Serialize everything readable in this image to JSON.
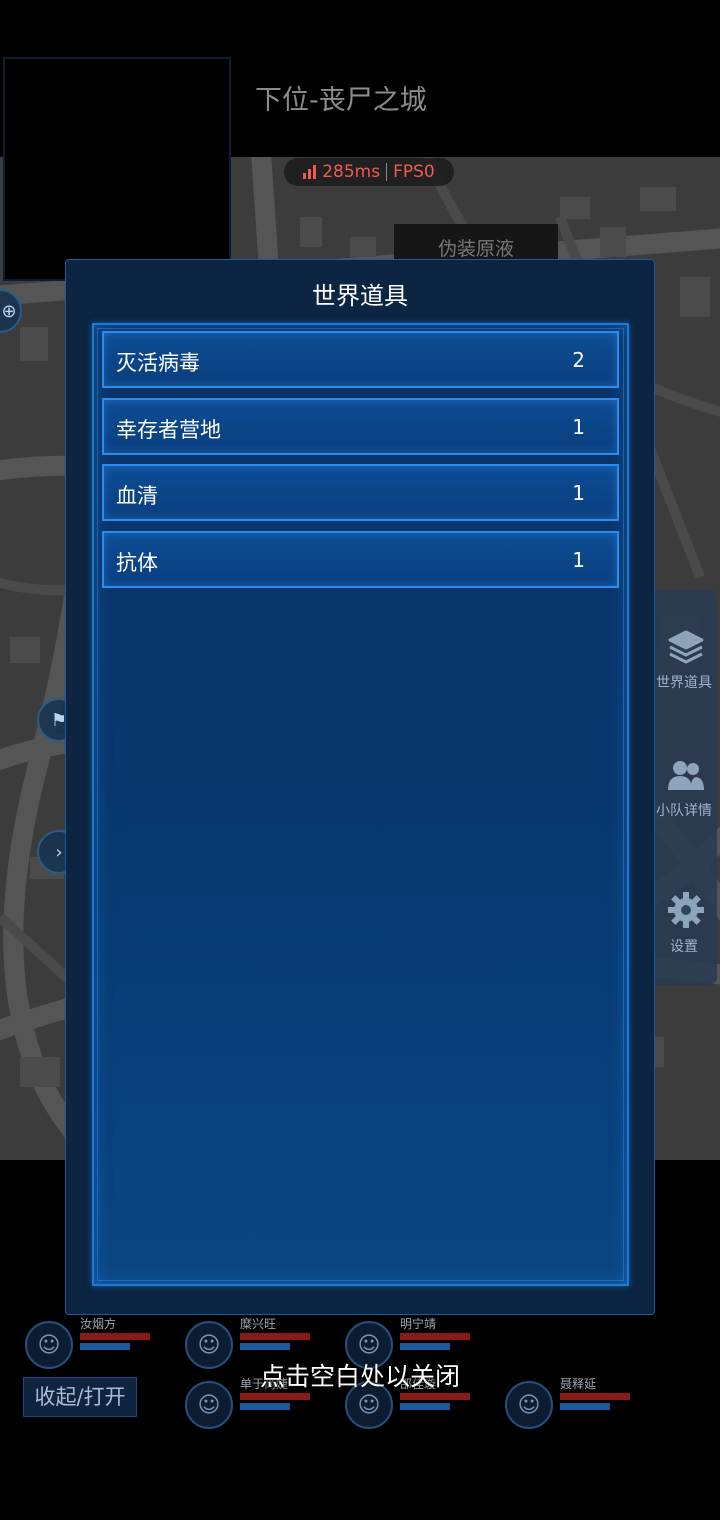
{
  "header": {
    "title": "下位-丧尸之城",
    "latency": "285ms",
    "fps": "FPS0",
    "map_label": "伪装原液"
  },
  "side_panel": {
    "items": [
      {
        "label": "世界道具",
        "icon": "layers-icon"
      },
      {
        "label": "小队详情",
        "icon": "team-icon"
      },
      {
        "label": "设置",
        "icon": "gear-icon"
      }
    ]
  },
  "modal": {
    "title": "世界道具",
    "items": [
      {
        "name": "灭活病毒",
        "count": "2"
      },
      {
        "name": "幸存者营地",
        "count": "1"
      },
      {
        "name": "血清",
        "count": "1"
      },
      {
        "name": "抗体",
        "count": "1"
      }
    ]
  },
  "team": {
    "toggle_label": "收起/打开",
    "members": [
      {
        "name": "汝烟方"
      },
      {
        "name": "糜兴旺"
      },
      {
        "name": "明宁靖"
      },
      {
        "name": "单于尚婕"
      },
      {
        "name": "邵佳璇"
      },
      {
        "name": "聂释延"
      }
    ]
  },
  "close_hint": "点击空白处以关闭",
  "colors": {
    "latency_red": "#f25a4f",
    "modal_border": "#2b8cf0",
    "modal_bg": "#0b2542"
  }
}
